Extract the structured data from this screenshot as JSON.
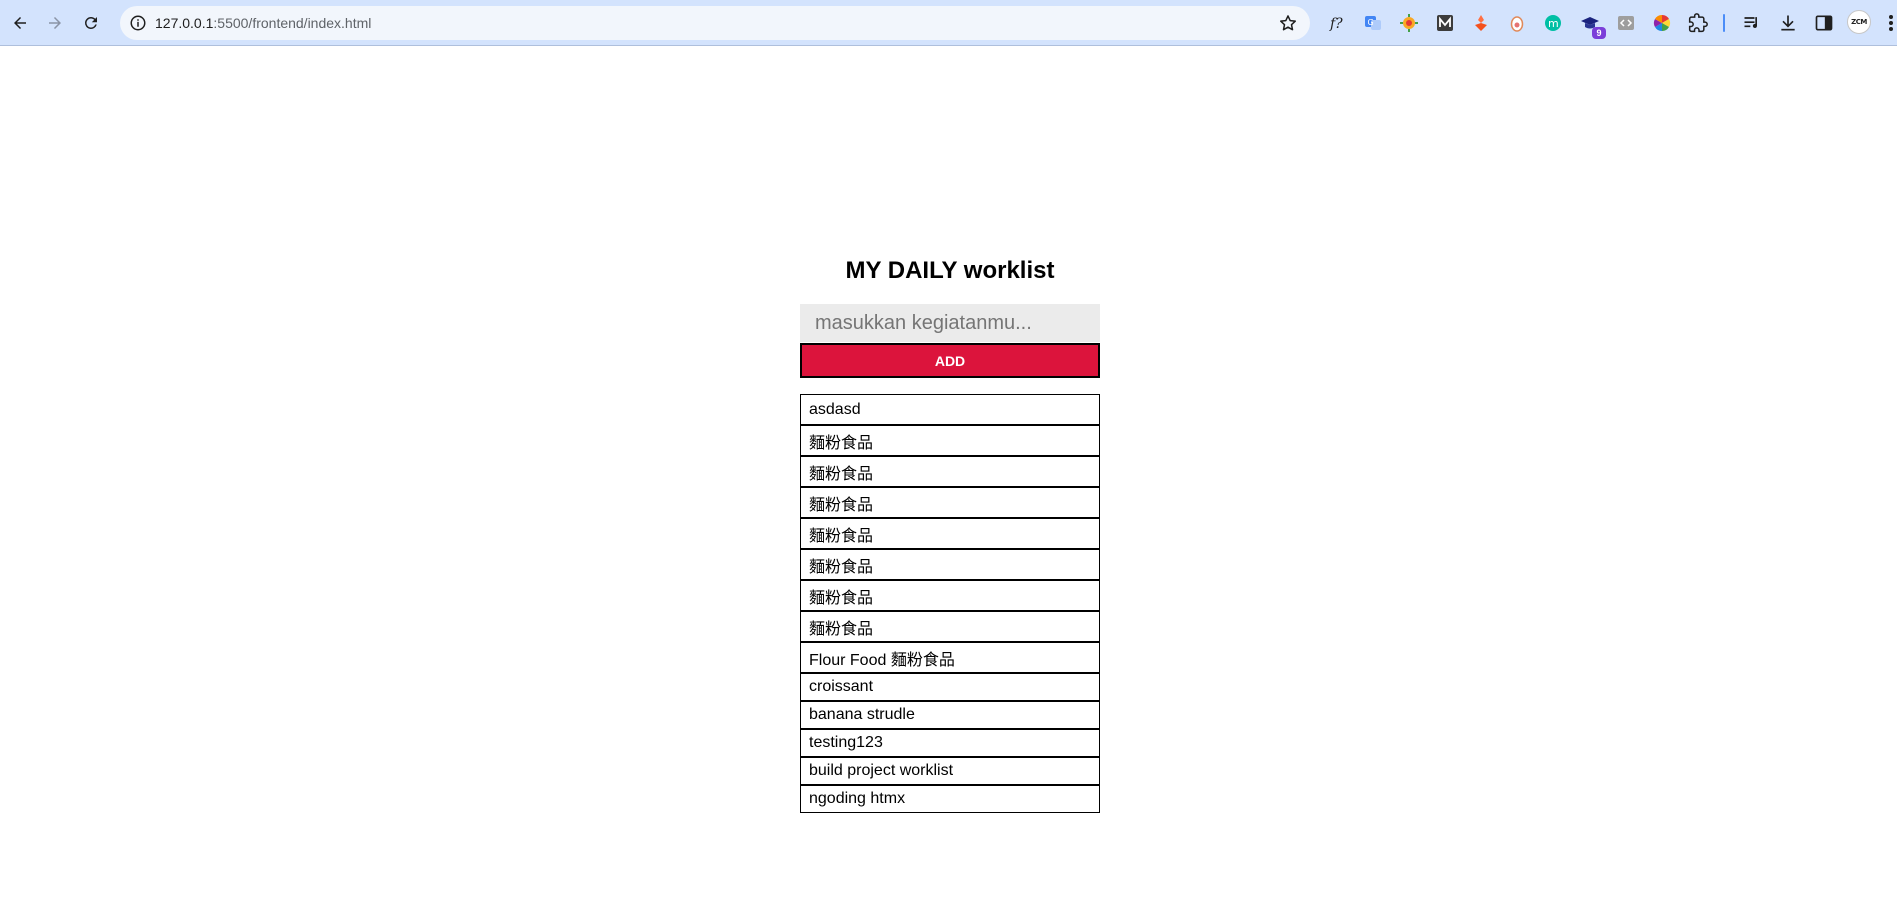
{
  "browser": {
    "url_host": "127.0.0.1",
    "url_rest": ":5500/frontend/index.html",
    "extension_badge": "9",
    "avatar_text": "ZCM"
  },
  "page": {
    "title": "MY DAILY worklist",
    "input_placeholder": "masukkan kegiatanmu...",
    "input_value": "",
    "add_button_label": "ADD"
  },
  "tasks": [
    "asdasd",
    "麵粉食品",
    "麵粉食品",
    "麵粉食品",
    "麵粉食品",
    "麵粉食品",
    "麵粉食品",
    "麵粉食品",
    "Flour Food 麵粉食品",
    "croissant",
    "banana strudle",
    "testing123",
    "build project worklist",
    "ngoding htmx"
  ],
  "colors": {
    "accent": "#dc143c",
    "chrome_bg": "#d3e3fd",
    "input_bg": "#ebebeb"
  }
}
